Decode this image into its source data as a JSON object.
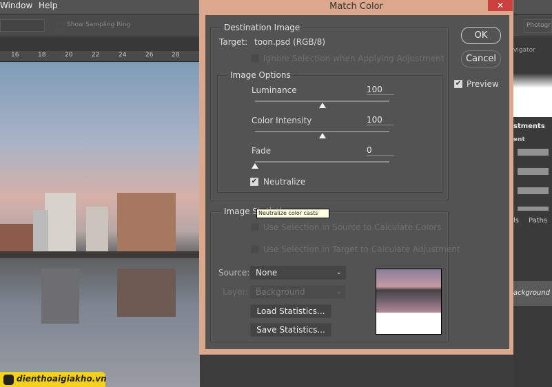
{
  "menubar": {
    "items": [
      "Window",
      "Help"
    ]
  },
  "options": {
    "show_sampling_ring": "Show Sampling Ring",
    "workspace": "Photogr"
  },
  "ruler": {
    "ticks": [
      "16",
      "18",
      "20",
      "22",
      "24",
      "26",
      "28"
    ]
  },
  "right_panel": {
    "navigator_tab": "vigator",
    "adjustments_tab": "stments",
    "adjustments_sub": "ent",
    "paths_tab": "Paths",
    "channels_tab": "ls",
    "layer_name": "ackground"
  },
  "dialog": {
    "title": "Match Color",
    "close": "✕",
    "ok": "OK",
    "cancel": "Cancel",
    "preview_label": "Preview",
    "preview_checked": true,
    "destination": {
      "legend": "Destination Image",
      "target_label": "Target:",
      "target_value": "toon.psd (RGB/8)",
      "ignore_selection": "Ignore Selection when Applying Adjustment"
    },
    "options": {
      "legend": "Image Options",
      "luminance": {
        "label": "Luminance",
        "value": "100",
        "level": 100,
        "max": 200
      },
      "color_intensity": {
        "label": "Color Intensity",
        "value": "100",
        "level": 100,
        "max": 200
      },
      "fade": {
        "label": "Fade",
        "value": "0",
        "level": 0,
        "max": 100
      },
      "neutralize": {
        "label": "Neutralize",
        "checked": true
      },
      "tooltip": "Neutralize color casts"
    },
    "statistics": {
      "legend": "Image Statistics",
      "use_sel_source": "Use Selection in Source to Calculate Colors",
      "use_sel_target": "Use Selection in Target to Calculate Adjustment",
      "source_label": "Source:",
      "source_value": "None",
      "layer_label": "Layer:",
      "layer_value": "Background",
      "load": "Load Statistics...",
      "save": "Save Statistics..."
    }
  },
  "watermark": "dienthoaigiakho.vn"
}
